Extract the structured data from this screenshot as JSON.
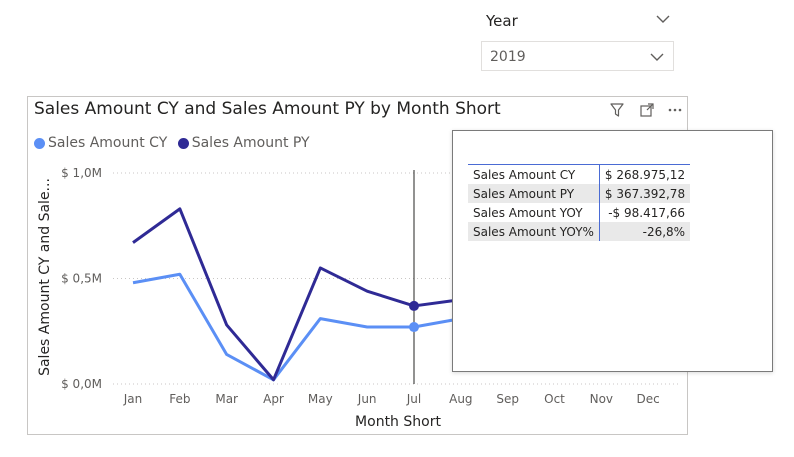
{
  "slicer": {
    "title": "Year",
    "value": "2019"
  },
  "visual": {
    "title": "Sales Amount CY and Sales Amount PY by Month Short",
    "icons": [
      "filter-icon",
      "focus-mode-icon",
      "more-options-icon"
    ]
  },
  "legend": {
    "items": [
      {
        "label": "Sales Amount CY",
        "color": "#5b8ff5"
      },
      {
        "label": "Sales Amount PY",
        "color": "#2f2a95"
      }
    ]
  },
  "chart_data": {
    "type": "line",
    "title": "Sales Amount CY and Sales Amount PY by Month Short",
    "xlabel": "Month Short",
    "ylabel": "Sales Amount CY and Sale...",
    "categories": [
      "Jan",
      "Feb",
      "Mar",
      "Apr",
      "May",
      "Jun",
      "Jul",
      "Aug",
      "Sep",
      "Oct",
      "Nov",
      "Dec"
    ],
    "yticks": [
      "$ 0,0M",
      "$ 0,5M",
      "$ 1,0M"
    ],
    "ylim": [
      0,
      1.0
    ],
    "grid": true,
    "legend_position": "top-left",
    "highlight_category": "Jul",
    "series": [
      {
        "name": "Sales Amount CY",
        "color": "#5b8ff5",
        "values": [
          0.48,
          0.52,
          0.14,
          0.02,
          0.31,
          0.27,
          0.27,
          0.31,
          null,
          null,
          null,
          null
        ]
      },
      {
        "name": "Sales Amount PY",
        "color": "#2f2a95",
        "values": [
          0.67,
          0.83,
          0.28,
          0.02,
          0.55,
          0.44,
          0.37,
          0.4,
          null,
          null,
          null,
          null
        ]
      }
    ]
  },
  "tooltip": {
    "rows": [
      {
        "label": "Sales Amount CY",
        "value": "$ 268.975,12"
      },
      {
        "label": "Sales Amount PY",
        "value": "$ 367.392,78"
      },
      {
        "label": "Sales Amount YOY",
        "value": "-$ 98.417,66"
      },
      {
        "label": "Sales Amount YOY%",
        "value": "-26,8%"
      }
    ]
  }
}
